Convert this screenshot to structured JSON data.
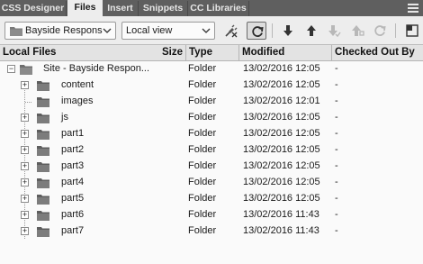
{
  "tabs": [
    {
      "label": "CSS Designer",
      "active": false
    },
    {
      "label": "Files",
      "active": true
    },
    {
      "label": "Insert",
      "active": false
    },
    {
      "label": "Snippets",
      "active": false
    },
    {
      "label": "CC Libraries",
      "active": false
    }
  ],
  "toolbar": {
    "site_select": "Bayside Respons",
    "view_select": "Local view"
  },
  "columns": {
    "name": "Local Files",
    "size": "Size",
    "type": "Type",
    "modified": "Modified",
    "checked_out_by": "Checked Out By"
  },
  "root": {
    "name": "Site - Bayside Respon...",
    "type": "Folder",
    "modified": "13/02/2016 12:05",
    "checked_out_by": "-"
  },
  "rows": [
    {
      "name": "content",
      "type": "Folder",
      "modified": "13/02/2016 12:05",
      "checked_out_by": "-",
      "expandable": true
    },
    {
      "name": "images",
      "type": "Folder",
      "modified": "13/02/2016 12:01",
      "checked_out_by": "-",
      "expandable": false
    },
    {
      "name": "js",
      "type": "Folder",
      "modified": "13/02/2016 12:05",
      "checked_out_by": "-",
      "expandable": true
    },
    {
      "name": "part1",
      "type": "Folder",
      "modified": "13/02/2016 12:05",
      "checked_out_by": "-",
      "expandable": true
    },
    {
      "name": "part2",
      "type": "Folder",
      "modified": "13/02/2016 12:05",
      "checked_out_by": "-",
      "expandable": true
    },
    {
      "name": "part3",
      "type": "Folder",
      "modified": "13/02/2016 12:05",
      "checked_out_by": "-",
      "expandable": true
    },
    {
      "name": "part4",
      "type": "Folder",
      "modified": "13/02/2016 12:05",
      "checked_out_by": "-",
      "expandable": true
    },
    {
      "name": "part5",
      "type": "Folder",
      "modified": "13/02/2016 12:05",
      "checked_out_by": "-",
      "expandable": true
    },
    {
      "name": "part6",
      "type": "Folder",
      "modified": "13/02/2016 11:43",
      "checked_out_by": "-",
      "expandable": true
    },
    {
      "name": "part7",
      "type": "Folder",
      "modified": "13/02/2016 11:43",
      "checked_out_by": "-",
      "expandable": true
    }
  ]
}
